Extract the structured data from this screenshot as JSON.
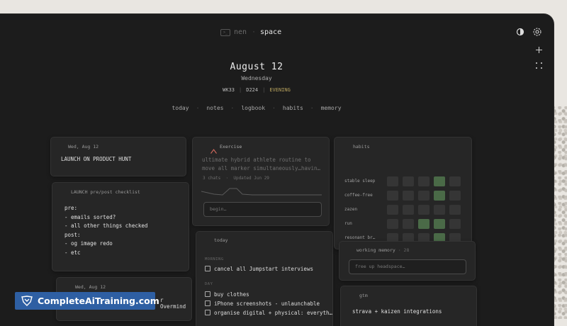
{
  "header": {
    "brand": "nen",
    "separator": "·",
    "workspace": "space"
  },
  "day": {
    "date": "August 12",
    "weekday": "Wednesday",
    "week": "WK33",
    "day_code": "D224",
    "period": "EVENING",
    "meta_sep": "|"
  },
  "nav": {
    "items": [
      "today",
      "notes",
      "logbook",
      "habits",
      "memory"
    ],
    "dot": "·"
  },
  "cards": {
    "launch": {
      "date": "Wed, Aug 12",
      "text": "LAUNCH ON PRODUCT HUNT"
    },
    "checklist": {
      "title": "LAUNCH pre/post checklist",
      "lines": [
        "pre:",
        "- emails sorted?",
        "- all other things checked",
        "post:",
        "- og image redo",
        "- etc"
      ]
    },
    "bottom_note": {
      "date": "Wed, Aug 12",
      "text_tail": "r Overmind"
    },
    "exercise": {
      "title": "Exercise",
      "desc1": "ultimate hybrid athlete routine to",
      "desc2": "move all marker simultaneously…havin…",
      "stats": "3 chats  ·  Updated Jun 29",
      "placeholder": "begin…"
    },
    "today": {
      "title": "today",
      "morning_label": "MORNING",
      "morning": [
        "cancel all Jumpstart interviews"
      ],
      "day_label": "DAY",
      "day": [
        "buy clothes",
        "iPhone screenshots - unlaunchable",
        "organise digital + physical: everyth…"
      ]
    },
    "habits": {
      "title": "habits",
      "rows": [
        {
          "name": "stable sleep",
          "cells": [
            0,
            0,
            0,
            1,
            0
          ]
        },
        {
          "name": "coffee-free",
          "cells": [
            0,
            0,
            0,
            1,
            0
          ]
        },
        {
          "name": "zazen",
          "cells": [
            0,
            0,
            0,
            0,
            0
          ]
        },
        {
          "name": "run",
          "cells": [
            0,
            0,
            1,
            1,
            0
          ]
        },
        {
          "name": "resonant br…",
          "cells": [
            0,
            0,
            0,
            1,
            0
          ]
        }
      ]
    },
    "memory": {
      "title": "working memory",
      "count": "· 28",
      "placeholder": "free up headspace…"
    },
    "gtm": {
      "title": "gtm",
      "text": "strava + kaizen integrations"
    }
  },
  "watermark": {
    "text": "CompleteAiTraining.com"
  },
  "colors": {
    "background": "#1c1c1c",
    "card": "#262626",
    "accent_evening": "#b9a45e",
    "habit_on": "#4a6a47",
    "watermark": "#2e5fa3"
  },
  "icons": [
    "contrast-icon",
    "gear-icon",
    "plus-icon",
    "grid-icon",
    "mountain-icon"
  ]
}
